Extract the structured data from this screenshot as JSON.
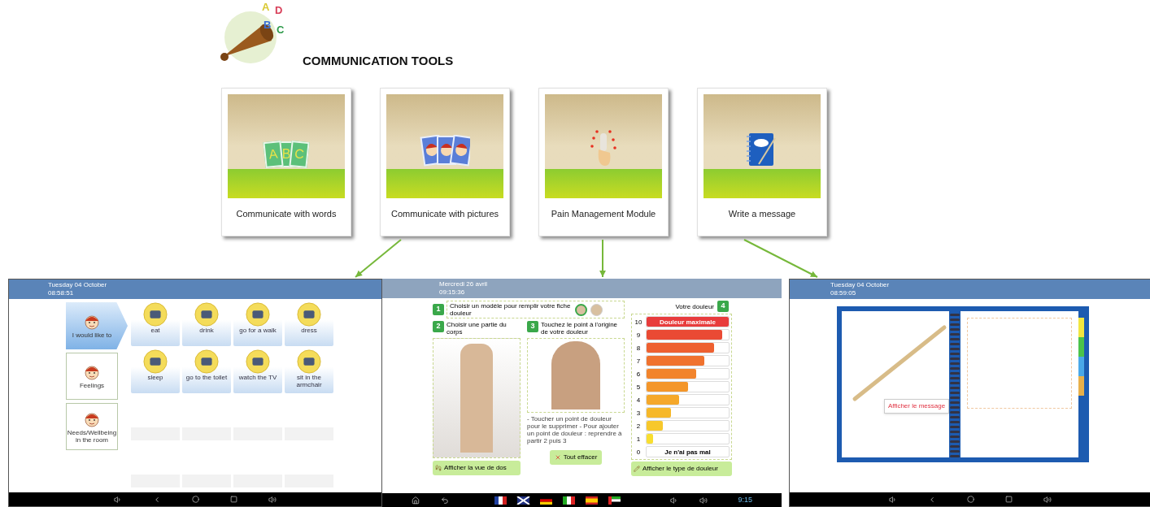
{
  "header": {
    "title": "COMMUNICATION TOOLS",
    "logo_letters": [
      {
        "text": "A",
        "color": "#d8c830"
      },
      {
        "text": "D",
        "color": "#d8405a"
      },
      {
        "text": "B",
        "color": "#3a6fd8"
      },
      {
        "text": "C",
        "color": "#2e9a4a"
      }
    ]
  },
  "tools": [
    {
      "kind": "words",
      "label": "Communicate with words",
      "card_letters": [
        "A",
        "B",
        "C"
      ]
    },
    {
      "kind": "pictures",
      "label": "Communicate with pictures"
    },
    {
      "kind": "pain",
      "label": "Pain Management Module"
    },
    {
      "kind": "message",
      "label": "Write a message"
    }
  ],
  "screens": {
    "pictograms": {
      "date": "Tuesday 04 October",
      "time": "08:58:51",
      "categories": [
        {
          "label": "I would like to",
          "selected": true
        },
        {
          "label": "Feelings",
          "selected": false
        },
        {
          "label": "Needs/Wellbeing in the room",
          "selected": false
        }
      ],
      "items": [
        {
          "label": "eat"
        },
        {
          "label": "drink"
        },
        {
          "label": "go for a walk"
        },
        {
          "label": "dress"
        },
        {
          "label": "sleep"
        },
        {
          "label": "go to the toilet"
        },
        {
          "label": "watch the TV"
        },
        {
          "label": "sit in the armchair"
        }
      ]
    },
    "pain": {
      "date": "Mercredi 26 avril",
      "time": "09:15:36",
      "steps": [
        {
          "number": "1",
          "text": "Choisir un modèle pour remplir votre fiche douleur"
        },
        {
          "number": "2",
          "text": "Choisir une partie du corps"
        },
        {
          "number": "3",
          "text": "Touchez le point à l'origine de votre douleur"
        },
        {
          "number": "4",
          "text": "Votre douleur"
        }
      ],
      "models": [
        {
          "selected": true
        },
        {
          "selected": false
        }
      ],
      "hint": "- Toucher un point de douleur pour le supprimer - Pour ajouter un point de douleur : reprendre à partir 2 puis 3",
      "scale": [
        {
          "number": "10",
          "level": 1,
          "color": "#e83c3c",
          "label": "Douleur maximale"
        },
        {
          "number": "9",
          "level": 0.92,
          "color": "#ea4a34"
        },
        {
          "number": "8",
          "level": 0.82,
          "color": "#ee6030"
        },
        {
          "number": "7",
          "level": 0.7,
          "color": "#f0722e"
        },
        {
          "number": "6",
          "level": 0.6,
          "color": "#f2842c"
        },
        {
          "number": "5",
          "level": 0.5,
          "color": "#f4962a"
        },
        {
          "number": "4",
          "level": 0.4,
          "color": "#f5a82a"
        },
        {
          "number": "3",
          "level": 0.3,
          "color": "#f6b82a"
        },
        {
          "number": "2",
          "level": 0.2,
          "color": "#f7c82c"
        },
        {
          "number": "1",
          "level": 0.08,
          "color": "#f8de30"
        },
        {
          "number": "0",
          "level": 0,
          "color": "#ffffff",
          "label": "Je n'ai pas mal"
        }
      ],
      "buttons": [
        "Afficher la vue de dos",
        "Tout effacer",
        "Afficher le type de douleur"
      ],
      "clock": "9:15"
    },
    "message": {
      "date": "Tuesday 04 October",
      "time": "08:59:05",
      "button": "Afficher le message",
      "tabs": [
        {
          "color": "#f2e640"
        },
        {
          "color": "#4cc34a"
        },
        {
          "color": "#4aa8e8"
        },
        {
          "color": "#e8b04a"
        }
      ]
    }
  }
}
